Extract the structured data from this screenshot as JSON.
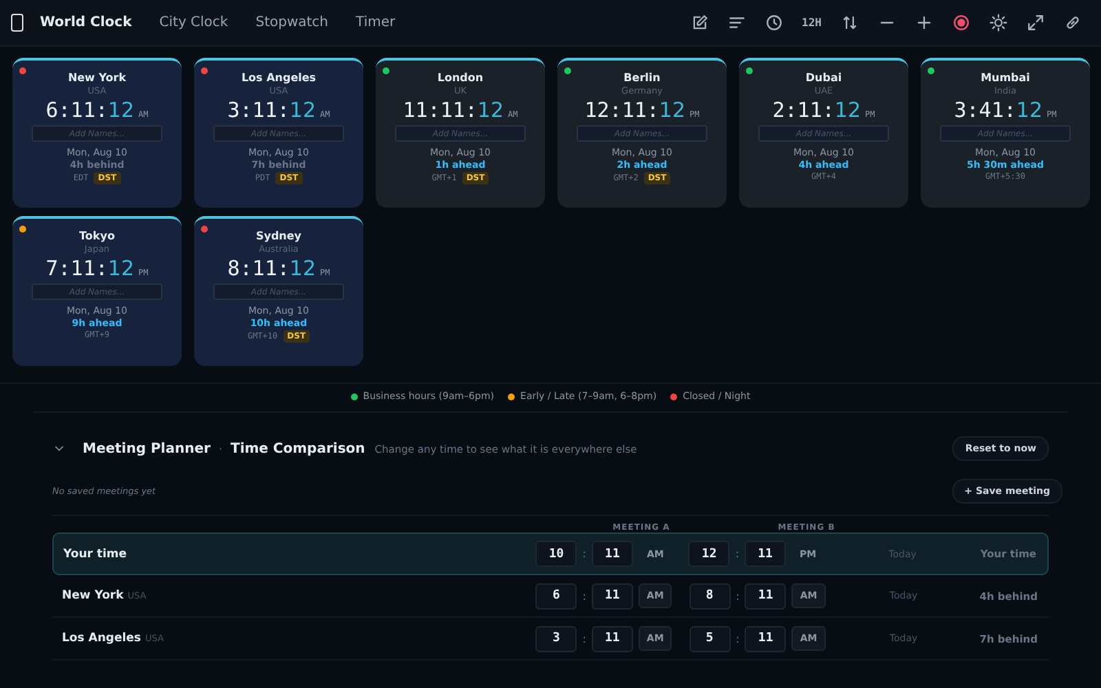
{
  "nav": {
    "title": "World Clock",
    "tabs": [
      {
        "label": "City Clock",
        "selected": false
      },
      {
        "label": "Stopwatch",
        "selected": false
      },
      {
        "label": "Timer",
        "selected": false
      }
    ]
  },
  "toolbar": {
    "format_label": "12H",
    "recording": true
  },
  "cities": [
    {
      "name": "New York",
      "country": "USA",
      "hm": "6:11:",
      "sec": "12",
      "ampm": "AM",
      "placeholder": "Add Names...",
      "date": "Mon, Aug 10",
      "diff": "4h behind",
      "ahead": false,
      "zone": "EDT",
      "dst": "DST",
      "kind": "closed",
      "color": "#ef4444"
    },
    {
      "name": "Los Angeles",
      "country": "USA",
      "hm": "3:11:",
      "sec": "12",
      "ampm": "AM",
      "placeholder": "Add Names...",
      "date": "Mon, Aug 10",
      "diff": "7h behind",
      "ahead": false,
      "zone": "PDT",
      "dst": "DST",
      "kind": "closed",
      "color": "#ef4444"
    },
    {
      "name": "London",
      "country": "UK",
      "hm": "11:11:",
      "sec": "12",
      "ampm": "AM",
      "placeholder": "Add Names...",
      "date": "Mon, Aug 10",
      "diff": "1h ahead",
      "ahead": true,
      "zone": "GMT+1",
      "dst": "DST",
      "kind": "business",
      "color": "#22c55e"
    },
    {
      "name": "Berlin",
      "country": "Germany",
      "hm": "12:11:",
      "sec": "12",
      "ampm": "PM",
      "placeholder": "Add Names...",
      "date": "Mon, Aug 10",
      "diff": "2h ahead",
      "ahead": true,
      "zone": "GMT+2",
      "dst": "DST",
      "kind": "business",
      "color": "#22c55e"
    },
    {
      "name": "Dubai",
      "country": "UAE",
      "hm": "2:11:",
      "sec": "12",
      "ampm": "PM",
      "placeholder": "Add Names...",
      "date": "Mon, Aug 10",
      "diff": "4h ahead",
      "ahead": true,
      "zone": "GMT+4",
      "kind": "business",
      "color": "#22c55e"
    },
    {
      "name": "Mumbai",
      "country": "India",
      "hm": "3:41:",
      "sec": "12",
      "ampm": "PM",
      "placeholder": "Add Names...",
      "date": "Mon, Aug 10",
      "diff": "5h 30m ahead",
      "ahead": true,
      "zone": "GMT+5:30",
      "kind": "business",
      "color": "#22c55e"
    },
    {
      "name": "Tokyo",
      "country": "Japan",
      "hm": "7:11:",
      "sec": "12",
      "ampm": "PM",
      "placeholder": "Add Names...",
      "date": "Mon, Aug 10",
      "diff": "9h ahead",
      "ahead": true,
      "zone": "GMT+9",
      "kind": "early",
      "color": "#f59e0b"
    },
    {
      "name": "Sydney",
      "country": "Australia",
      "hm": "8:11:",
      "sec": "12",
      "ampm": "PM",
      "placeholder": "Add Names...",
      "date": "Mon, Aug 10",
      "diff": "10h ahead",
      "ahead": true,
      "zone": "GMT+10",
      "dst": "DST",
      "kind": "closed",
      "color": "#ef4444"
    }
  ],
  "legend": [
    {
      "label": "Business hours (9am–6pm)",
      "color": "#22c55e"
    },
    {
      "label": "Early / Late (7–9am, 6–8pm)",
      "color": "#f59e0b"
    },
    {
      "label": "Closed / Night",
      "color": "#ef4444"
    }
  ],
  "planner": {
    "expanded": true,
    "title": "Meeting Planner",
    "separator": "·",
    "subtitle": "Time Comparison",
    "hint": "Change any time to see what it is everywhere else",
    "reset": "Reset to now",
    "empty": "No saved meetings yet",
    "save": "+ Save meeting",
    "columns": [
      "MEETING A",
      "MEETING B"
    ],
    "rows": [
      {
        "name": "Your time",
        "selected": true,
        "a": {
          "h": "10",
          "sep": ":",
          "m": "11",
          "ap": "AM"
        },
        "b": {
          "h": "12",
          "sep": ":",
          "m": "11",
          "ap": "PM"
        },
        "day": "Today",
        "diff": "Your time"
      },
      {
        "name": "New York",
        "country": "USA",
        "selected": false,
        "a": {
          "h": "6",
          "sep": ":",
          "m": "11",
          "ap": "AM"
        },
        "b": {
          "h": "8",
          "sep": ":",
          "m": "11",
          "ap": "AM"
        },
        "day": "Today",
        "diff": "4h behind"
      },
      {
        "name": "Los Angeles",
        "country": "USA",
        "selected": false,
        "a": {
          "h": "3",
          "sep": ":",
          "m": "11",
          "ap": "AM"
        },
        "b": {
          "h": "5",
          "sep": ":",
          "m": "11",
          "ap": "AM"
        },
        "day": "Today",
        "diff": "7h behind"
      }
    ]
  }
}
